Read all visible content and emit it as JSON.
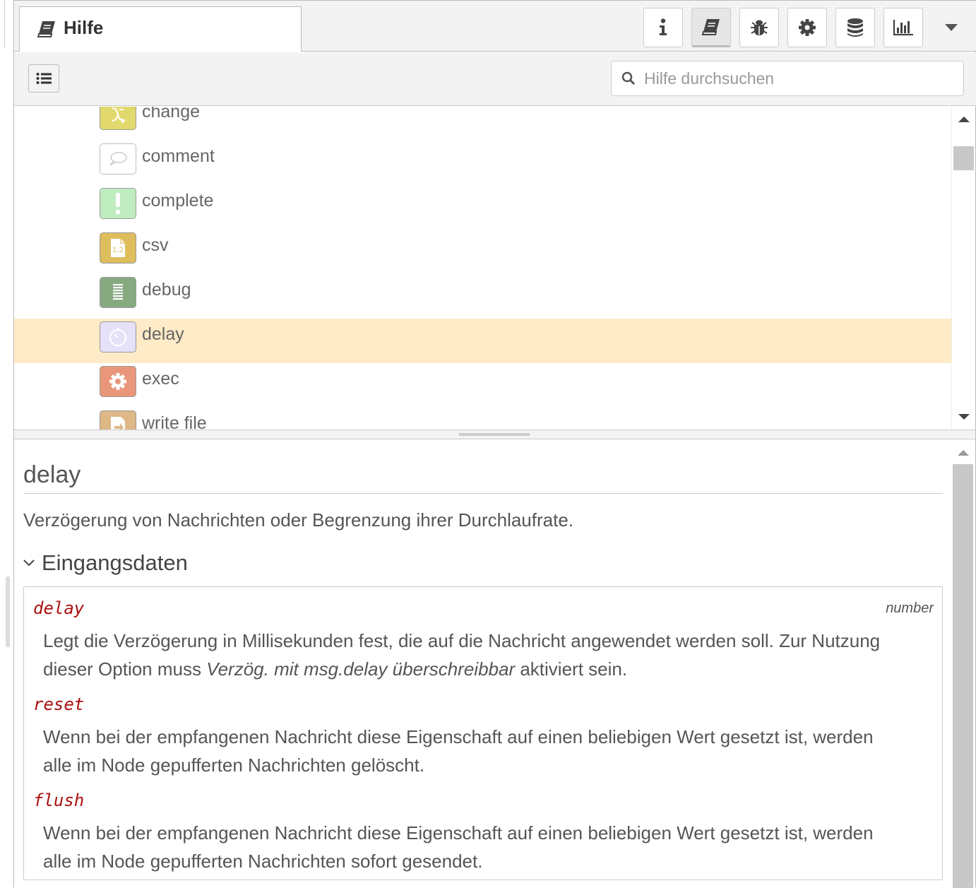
{
  "tab": {
    "label": "Hilfe",
    "icon": "book-icon"
  },
  "toolbar_buttons": [
    {
      "name": "info-icon",
      "selected": false
    },
    {
      "name": "book-icon",
      "selected": true
    },
    {
      "name": "bug-icon",
      "selected": false
    },
    {
      "name": "gear-icon",
      "selected": false
    },
    {
      "name": "database-icon",
      "selected": false
    },
    {
      "name": "bar-chart-icon",
      "selected": false
    }
  ],
  "search": {
    "placeholder": "Hilfe durchsuchen"
  },
  "nodes": [
    {
      "label": "change",
      "color": "#e2d96e",
      "icon": "shuffle-icon"
    },
    {
      "label": "comment",
      "color": "#ffffff",
      "icon": "speech-bubble-icon"
    },
    {
      "label": "complete",
      "color": "#c0edc0",
      "icon": "exclamation-icon"
    },
    {
      "label": "csv",
      "color": "#debd5c",
      "icon": "file-csv-icon"
    },
    {
      "label": "debug",
      "color": "#87a980",
      "icon": "list-icon",
      "selected": false
    },
    {
      "label": "delay",
      "color": "#e6e0f8",
      "icon": "timer-icon",
      "selected": true
    },
    {
      "label": "exec",
      "color": "#e9967a",
      "icon": "cog-icon"
    },
    {
      "label": "write file",
      "color": "#deb887",
      "icon": "file-out-icon"
    }
  ],
  "help": {
    "title": "delay",
    "description": "Verzögerung von Nachrichten oder Begrenzung ihrer Durchlaufrate.",
    "section": "Eingangsdaten",
    "props": [
      {
        "name": "delay",
        "type": "number",
        "desc_before": "Legt die Verzögerung in Millisekunden fest, die auf die Nachricht angewendet werden soll. Zur Nutzung dieser Option muss ",
        "desc_em": "Verzög. mit msg.delay überschreibbar",
        "desc_after": " aktiviert sein."
      },
      {
        "name": "reset",
        "type": "",
        "desc": "Wenn bei der empfangenen Nachricht diese Eigenschaft auf einen beliebigen Wert gesetzt ist, werden alle im Node gepufferten Nachrichten gelöscht."
      },
      {
        "name": "flush",
        "type": "",
        "desc": "Wenn bei der empfangenen Nachricht diese Eigenschaft auf einen beliebigen Wert gesetzt ist, werden alle im Node gepufferten Nachrichten sofort gesendet."
      }
    ]
  },
  "colors": {
    "accent_red": "#aa1111",
    "selected_row": "#ffebc7"
  }
}
